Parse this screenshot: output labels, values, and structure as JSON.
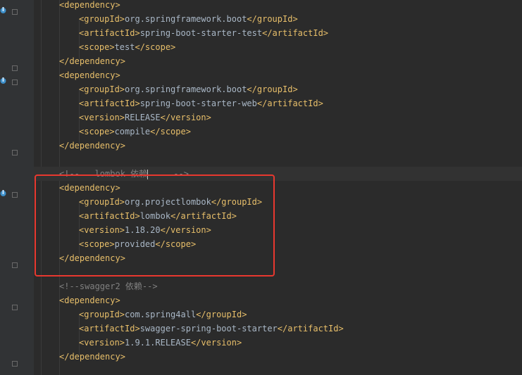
{
  "editor": {
    "lines": [
      {
        "indent": 1,
        "parts": [
          [
            "tag",
            "<dependency>"
          ]
        ]
      },
      {
        "indent": 2,
        "parts": [
          [
            "tag",
            "<groupId>"
          ],
          [
            "txt",
            "org.springframework.boot"
          ],
          [
            "tag",
            "</groupId>"
          ]
        ]
      },
      {
        "indent": 2,
        "parts": [
          [
            "tag",
            "<artifactId>"
          ],
          [
            "txt",
            "spring-boot-starter-test"
          ],
          [
            "tag",
            "</artifactId>"
          ]
        ]
      },
      {
        "indent": 2,
        "parts": [
          [
            "tag",
            "<scope>"
          ],
          [
            "txt",
            "test"
          ],
          [
            "tag",
            "</scope>"
          ]
        ]
      },
      {
        "indent": 1,
        "parts": [
          [
            "tag",
            "</dependency>"
          ]
        ]
      },
      {
        "indent": 1,
        "parts": [
          [
            "tag",
            "<dependency>"
          ]
        ]
      },
      {
        "indent": 2,
        "parts": [
          [
            "tag",
            "<groupId>"
          ],
          [
            "txt",
            "org.springframework.boot"
          ],
          [
            "tag",
            "</groupId>"
          ]
        ]
      },
      {
        "indent": 2,
        "parts": [
          [
            "tag",
            "<artifactId>"
          ],
          [
            "txt",
            "spring-boot-starter-web"
          ],
          [
            "tag",
            "</artifactId>"
          ]
        ]
      },
      {
        "indent": 2,
        "parts": [
          [
            "tag",
            "<version>"
          ],
          [
            "txt",
            "RELEASE"
          ],
          [
            "tag",
            "</version>"
          ]
        ]
      },
      {
        "indent": 2,
        "parts": [
          [
            "tag",
            "<scope>"
          ],
          [
            "txt",
            "compile"
          ],
          [
            "tag",
            "</scope>"
          ]
        ]
      },
      {
        "indent": 1,
        "parts": [
          [
            "tag",
            "</dependency>"
          ]
        ]
      },
      {
        "indent": 0,
        "parts": []
      },
      {
        "indent": 1,
        "current": true,
        "parts": [
          [
            "cmt",
            "<!--   lombok 依赖"
          ],
          [
            "caret",
            ""
          ],
          [
            "cmt",
            "     -->"
          ]
        ]
      },
      {
        "indent": 1,
        "parts": [
          [
            "tag",
            "<dependency>"
          ]
        ]
      },
      {
        "indent": 2,
        "parts": [
          [
            "tag",
            "<groupId>"
          ],
          [
            "txt",
            "org.projectlombok"
          ],
          [
            "tag",
            "</groupId>"
          ]
        ]
      },
      {
        "indent": 2,
        "parts": [
          [
            "tag",
            "<artifactId>"
          ],
          [
            "txt",
            "lombok"
          ],
          [
            "tag",
            "</artifactId>"
          ]
        ]
      },
      {
        "indent": 2,
        "parts": [
          [
            "tag",
            "<version>"
          ],
          [
            "txt",
            "1.18.20"
          ],
          [
            "tag",
            "</version>"
          ]
        ]
      },
      {
        "indent": 2,
        "parts": [
          [
            "tag",
            "<scope>"
          ],
          [
            "txt",
            "provided"
          ],
          [
            "tag",
            "</scope>"
          ]
        ]
      },
      {
        "indent": 1,
        "parts": [
          [
            "tag",
            "</dependency>"
          ]
        ]
      },
      {
        "indent": 0,
        "parts": []
      },
      {
        "indent": 1,
        "parts": [
          [
            "cmt",
            "<!--swagger2 依赖-->"
          ]
        ]
      },
      {
        "indent": 1,
        "parts": [
          [
            "tag",
            "<dependency>"
          ]
        ]
      },
      {
        "indent": 2,
        "parts": [
          [
            "tag",
            "<groupId>"
          ],
          [
            "txt",
            "com.spring4all"
          ],
          [
            "tag",
            "</groupId>"
          ]
        ]
      },
      {
        "indent": 2,
        "parts": [
          [
            "tag",
            "<artifactId>"
          ],
          [
            "txt",
            "swagger-spring-boot-starter"
          ],
          [
            "tag",
            "</artifactId>"
          ]
        ]
      },
      {
        "indent": 2,
        "parts": [
          [
            "tag",
            "<version>"
          ],
          [
            "txt",
            "1.9.1.RELEASE"
          ],
          [
            "tag",
            "</version>"
          ]
        ]
      },
      {
        "indent": 1,
        "parts": [
          [
            "tag",
            "</dependency>"
          ]
        ]
      }
    ]
  },
  "colors": {
    "background": "#2b2b2b",
    "tag": "#e8bf6a",
    "text": "#a9b7c6",
    "comment": "#808080",
    "highlight_box": "#e8382f"
  }
}
